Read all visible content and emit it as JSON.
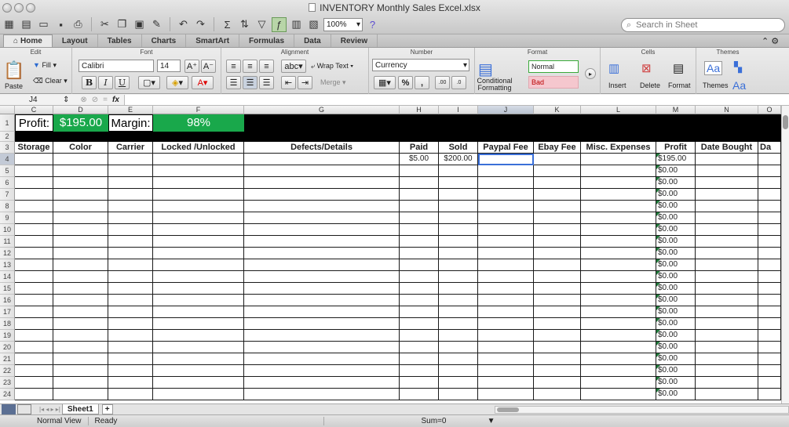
{
  "window": {
    "title": "INVENTORY Monthly Sales Excel.xlsx"
  },
  "toolbar": {
    "zoom": "100%",
    "search_placeholder": "Search in Sheet"
  },
  "ribbon_tabs": [
    "Home",
    "Layout",
    "Tables",
    "Charts",
    "SmartArt",
    "Formulas",
    "Data",
    "Review"
  ],
  "ribbon": {
    "edit": {
      "title": "Edit",
      "paste": "Paste",
      "fill": "Fill",
      "clear": "Clear"
    },
    "font": {
      "title": "Font",
      "name": "Calibri",
      "size": "14",
      "bold": "B",
      "italic": "I",
      "underline": "U"
    },
    "alignment": {
      "title": "Alignment",
      "abc": "abc",
      "wrap": "Wrap Text",
      "merge": "Merge"
    },
    "number": {
      "title": "Number",
      "format": "Currency",
      "percent": "%",
      "comma": ","
    },
    "format": {
      "title": "Format",
      "conditional": "Conditional Formatting",
      "normal": "Normal",
      "bad": "Bad"
    },
    "cells": {
      "title": "Cells",
      "insert": "Insert",
      "delete": "Delete",
      "format": "Format"
    },
    "themes": {
      "title": "Themes",
      "themes": "Themes",
      "aa": "Aa"
    }
  },
  "formula_bar": {
    "name_box": "J4",
    "fx": "fx"
  },
  "columns": [
    {
      "id": "C",
      "w": 49
    },
    {
      "id": "D",
      "w": 70
    },
    {
      "id": "E",
      "w": 57
    },
    {
      "id": "F",
      "w": 116
    },
    {
      "id": "G",
      "w": 198
    },
    {
      "id": "H",
      "w": 50
    },
    {
      "id": "I",
      "w": 50
    },
    {
      "id": "J",
      "w": 71
    },
    {
      "id": "K",
      "w": 60
    },
    {
      "id": "L",
      "w": 96
    },
    {
      "id": "M",
      "w": 50
    },
    {
      "id": "N",
      "w": 80
    },
    {
      "id": "O",
      "w": 29
    }
  ],
  "header_row": {
    "profit_label": "Profit:",
    "profit_value": "$195.00",
    "margin_label": "Margin:",
    "margin_value": "98%"
  },
  "table_headers": [
    "Storage",
    "Color",
    "Carrier",
    "Locked /Unlocked",
    "Defects/Details",
    "Paid",
    "Sold",
    "Paypal Fee",
    "Ebay Fee",
    "Misc. Expenses",
    "Profit",
    "Date Bought",
    "Da"
  ],
  "row4": {
    "paid": "$5.00",
    "sold": "$200.00",
    "profit": "$195.00"
  },
  "profit_zero": "$0.00",
  "sheet_tab": "Sheet1",
  "status": {
    "view": "Normal View",
    "state": "Ready",
    "sum": "Sum=0"
  },
  "colors": {
    "accent_green": "#19a84b",
    "header_black": "#000000",
    "selection_blue": "#3a6fd8"
  }
}
